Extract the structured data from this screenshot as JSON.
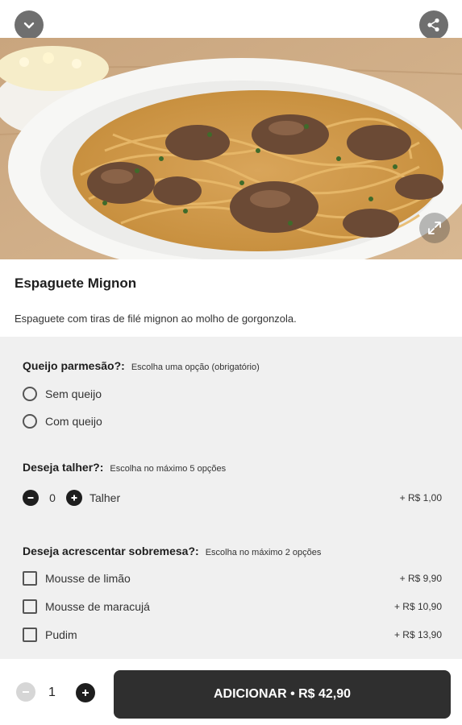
{
  "header": {
    "back_icon": "chevron-down-icon",
    "share_icon": "share-icon",
    "expand_icon": "expand-icon"
  },
  "product": {
    "name": "Espaguete Mignon",
    "description": "Espaguete com tiras de filé mignon ao molho de gorgonzola."
  },
  "groups": {
    "cheese": {
      "title": "Queijo parmesão?:",
      "hint": "Escolha uma opção (obrigatório)",
      "options": [
        "Sem queijo",
        "Com queijo"
      ]
    },
    "cutlery": {
      "title": "Deseja talher?:",
      "hint": "Escolha no máximo 5 opções",
      "item_label": "Talher",
      "quantity": "0",
      "price": "+ R$ 1,00"
    },
    "dessert": {
      "title": "Deseja acrescentar sobremesa?:",
      "hint": "Escolha no máximo 2 opções",
      "items": [
        {
          "label": "Mousse de limão",
          "price": "+ R$ 9,90"
        },
        {
          "label": "Mousse de maracujá",
          "price": "+ R$ 10,90"
        },
        {
          "label": "Pudim",
          "price": "+ R$ 13,90"
        }
      ]
    }
  },
  "footer": {
    "quantity": "1",
    "add_label": "ADICIONAR • R$ 42,90"
  },
  "colors": {
    "dark": "#2f2f2f",
    "options_bg": "#f0f0f0",
    "icon_grey": "#6f6f6f"
  }
}
